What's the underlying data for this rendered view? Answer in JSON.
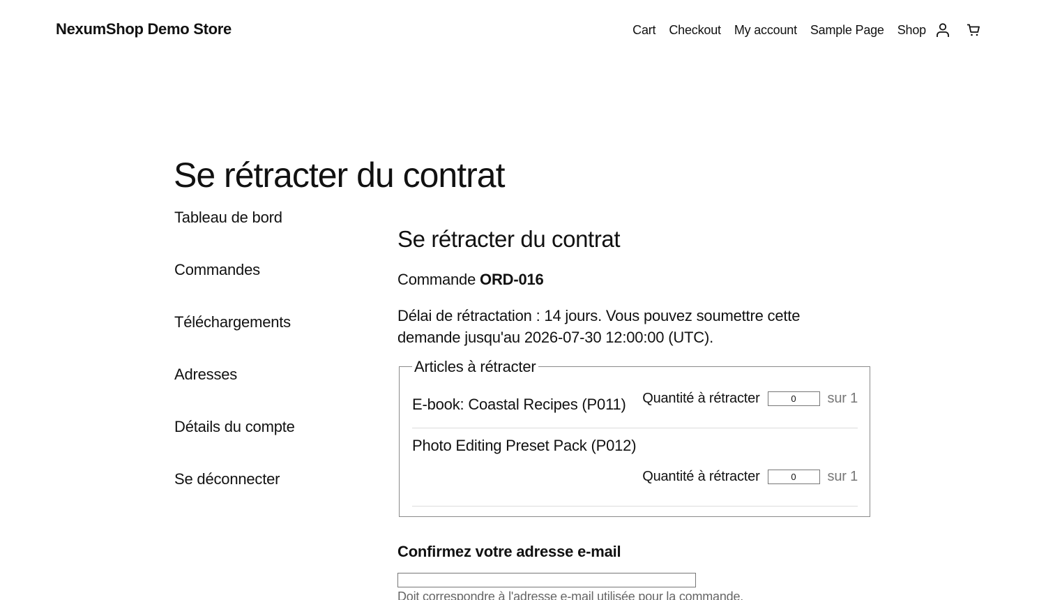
{
  "header": {
    "site_title": "NexumShop Demo Store",
    "nav": [
      "Cart",
      "Checkout",
      "My account",
      "Sample Page",
      "Shop"
    ],
    "icons": [
      "account-icon",
      "cart-icon"
    ]
  },
  "page_title": "Se rétracter du contrat",
  "account_nav": [
    "Tableau de bord",
    "Commandes",
    "Téléchargements",
    "Adresses",
    "Détails du compte",
    "Se déconnecter"
  ],
  "form": {
    "heading": "Se rétracter du contrat",
    "order_prefix": "Commande",
    "order_id": "ORD-016",
    "deadline_text": "Délai de rétractation : 14 jours. Vous pouvez soumettre cette demande jusqu'au 2026-07-30 12:00:00 (UTC).",
    "articles_legend": "Articles à rétracter",
    "items": [
      {
        "name": "E-book: Coastal Recipes (P011)",
        "qty_label": "Quantité à rétracter",
        "qty_value": "0",
        "qty_of": "sur 1"
      },
      {
        "name": "Photo Editing Preset Pack (P012)",
        "qty_label": "Quantité à rétracter",
        "qty_value": "0",
        "qty_of": "sur 1"
      }
    ],
    "email_label": "Confirmez votre adresse e-mail",
    "email_value": "",
    "email_help": "Doit correspondre à l'adresse e-mail utilisée pour la commande."
  }
}
